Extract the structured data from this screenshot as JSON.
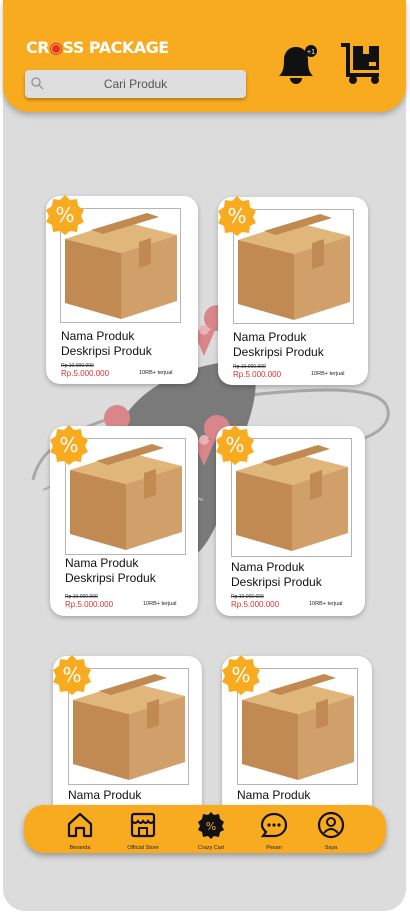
{
  "app": {
    "logo_text_a": "CR",
    "logo_text_b": "SS PACKAGE"
  },
  "search": {
    "placeholder": "Cari Produk"
  },
  "header": {
    "notification_count": "+1"
  },
  "products": [
    {
      "name": "Nama Produk",
      "desc": "Deskripsi Produk",
      "old_price": "Rp.10.000.000",
      "price": "Rp.5.000.000",
      "sold": "10RB+ terjual"
    },
    {
      "name": "Nama Produk",
      "desc": "Deskripsi Produk",
      "old_price": "Rp.10.000.000",
      "price": "Rp.5.000.000",
      "sold": "10RB+ terjual"
    },
    {
      "name": "Nama Produk",
      "desc": "Deskripsi Produk",
      "old_price": "Rp.10.000.000",
      "price": "Rp.5.000.000",
      "sold": "10RB+ terjual"
    },
    {
      "name": "Nama Produk",
      "desc": "Deskripsi Produk",
      "old_price": "Rp.10.000.000",
      "price": "Rp.5.000.000",
      "sold": "10RB+ terjual"
    },
    {
      "name": "Nama Produk",
      "desc": "",
      "old_price": "",
      "price": "",
      "sold": ""
    },
    {
      "name": "Nama Produk",
      "desc": "",
      "old_price": "",
      "price": "",
      "sold": ""
    }
  ],
  "badge": {
    "symbol": "%"
  },
  "nav": [
    {
      "label": "Beranda",
      "icon": "home-icon"
    },
    {
      "label": "Official Store",
      "icon": "store-icon"
    },
    {
      "label": "Crazy Cart",
      "icon": "discount-icon"
    },
    {
      "label": "Pesan",
      "icon": "chat-icon"
    },
    {
      "label": "Saya",
      "icon": "profile-icon"
    }
  ],
  "colors": {
    "accent": "#f9ab1f",
    "price": "#e0322b",
    "background": "#dcdcdc"
  }
}
